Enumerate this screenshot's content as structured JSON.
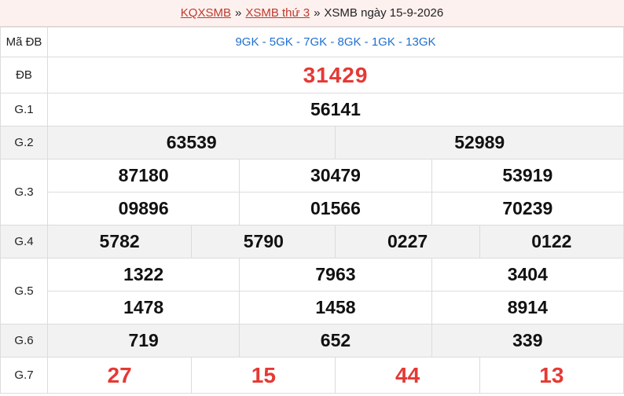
{
  "breadcrumb": {
    "item1": "KQXSMB",
    "item2": "XSMB thứ 3",
    "item3": "XSMB ngày 15-9-2026",
    "sep": "»"
  },
  "table": {
    "code_label": "Mã ĐB",
    "code_value": "9GK - 5GK - 7GK - 8GK - 1GK - 13GK",
    "db_label": "ĐB",
    "db_value": "31429",
    "g1_label": "G.1",
    "g1": [
      "56141"
    ],
    "g2_label": "G.2",
    "g2": [
      "63539",
      "52989"
    ],
    "g3_label": "G.3",
    "g3": [
      "87180",
      "30479",
      "53919",
      "09896",
      "01566",
      "70239"
    ],
    "g4_label": "G.4",
    "g4": [
      "5782",
      "5790",
      "0227",
      "0122"
    ],
    "g5_label": "G.5",
    "g5": [
      "1322",
      "7963",
      "3404",
      "1478",
      "1458",
      "8914"
    ],
    "g6_label": "G.6",
    "g6": [
      "719",
      "652",
      "339"
    ],
    "g7_label": "G.7",
    "g7": [
      "27",
      "15",
      "44",
      "13"
    ]
  },
  "colors": {
    "accent_red": "#e53935",
    "link_red": "#c0392b",
    "code_blue": "#1e6fd0",
    "row_shade": "#f2f2f2"
  }
}
